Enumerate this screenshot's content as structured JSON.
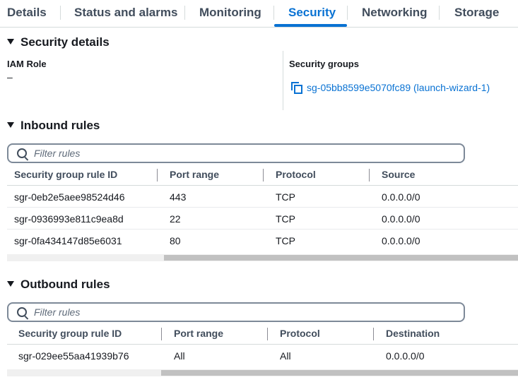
{
  "tabs": [
    {
      "label": "Details",
      "active": false
    },
    {
      "label": "Status and alarms",
      "active": false
    },
    {
      "label": "Monitoring",
      "active": false
    },
    {
      "label": "Security",
      "active": true
    },
    {
      "label": "Networking",
      "active": false
    },
    {
      "label": "Storage",
      "active": false
    }
  ],
  "security_details": {
    "title": "Security details",
    "iam_role_label": "IAM Role",
    "iam_role_value": "–",
    "security_groups_label": "Security groups",
    "security_group_link": "sg-05bb8599e5070fc89 (launch-wizard-1)"
  },
  "inbound": {
    "title": "Inbound rules",
    "filter_placeholder": "Filter rules",
    "columns": [
      "Security group rule ID",
      "Port range",
      "Protocol",
      "Source"
    ],
    "rows": [
      [
        "sgr-0eb2e5aee98524d46",
        "443",
        "TCP",
        "0.0.0.0/0"
      ],
      [
        "sgr-0936993e811c9ea8d",
        "22",
        "TCP",
        "0.0.0.0/0"
      ],
      [
        "sgr-0fa434147d85e6031",
        "80",
        "TCP",
        "0.0.0.0/0"
      ]
    ]
  },
  "outbound": {
    "title": "Outbound rules",
    "filter_placeholder": "Filter rules",
    "columns": [
      "Security group rule ID",
      "Port range",
      "Protocol",
      "Destination"
    ],
    "rows": [
      [
        "sgr-029ee55aa41939b76",
        "All",
        "All",
        "0.0.0.0/0"
      ]
    ]
  },
  "colors": {
    "accent": "#0972d3",
    "text": "#16191f",
    "muted": "#414d5c"
  }
}
